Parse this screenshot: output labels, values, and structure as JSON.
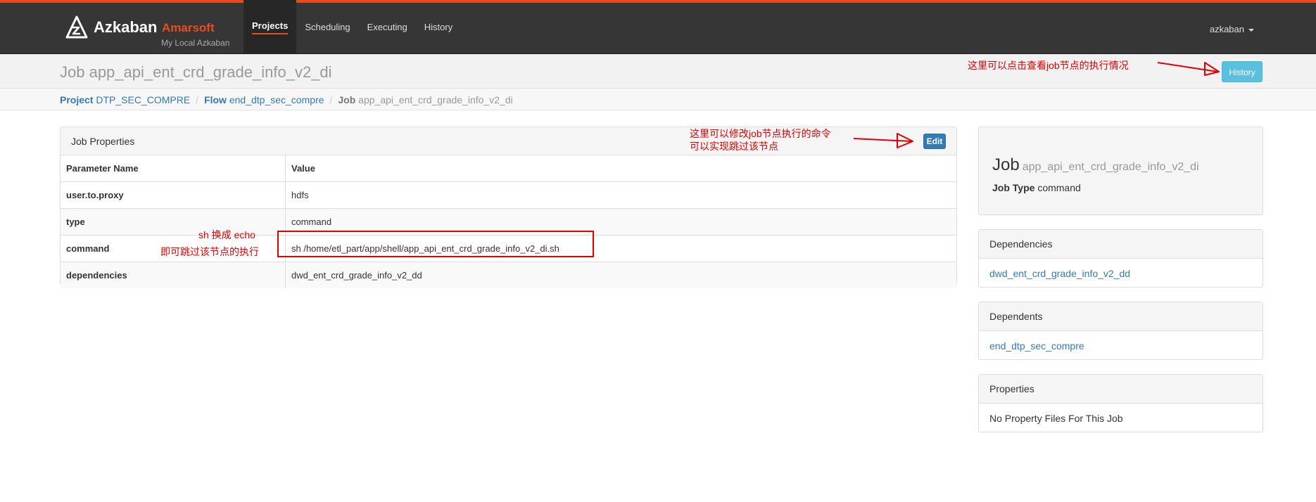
{
  "navbar": {
    "brand_name": "Azkaban",
    "brand_sub": "Amarsoft",
    "instance": "My Local Azkaban",
    "items": [
      {
        "label": "Projects",
        "active": true
      },
      {
        "label": "Scheduling",
        "active": false
      },
      {
        "label": "Executing",
        "active": false
      },
      {
        "label": "History",
        "active": false
      }
    ],
    "user": "azkaban",
    "accent_color": "#e84c1e"
  },
  "header": {
    "title": "Job app_api_ent_crd_grade_info_v2_di",
    "history_button": "History"
  },
  "breadcrumb": {
    "project_label": "Project",
    "project": "DTP_SEC_COMPRE",
    "flow_label": "Flow",
    "flow": "end_dtp_sec_compre",
    "job_label": "Job",
    "job": "app_api_ent_crd_grade_info_v2_di"
  },
  "properties": {
    "title": "Job Properties",
    "edit_button": "Edit",
    "columns": [
      "Parameter Name",
      "Value"
    ],
    "rows": [
      {
        "name": "user.to.proxy",
        "value": "hdfs"
      },
      {
        "name": "type",
        "value": "command"
      },
      {
        "name": "command",
        "value": "sh /home/etl_part/app/shell/app_api_ent_crd_grade_info_v2_di.sh"
      },
      {
        "name": "dependencies",
        "value": "dwd_ent_crd_grade_info_v2_dd"
      }
    ]
  },
  "summary": {
    "job_word": "Job",
    "job_name": "app_api_ent_crd_grade_info_v2_di",
    "type_label": "Job Type",
    "type_value": "command"
  },
  "dependencies": {
    "title": "Dependencies",
    "item": "dwd_ent_crd_grade_info_v2_dd"
  },
  "dependents": {
    "title": "Dependents",
    "item": "end_dtp_sec_compre"
  },
  "property_files": {
    "title": "Properties",
    "item": "No Property Files For This Job"
  },
  "annotations": {
    "history_note": "这里可以点击查看job节点的执行情况",
    "edit_note_line1": "这里可以修改job节点执行的命令",
    "edit_note_line2": "可以实现跳过该节点",
    "command_note_line1": "sh 换成 echo",
    "command_note_line2": "即可跳过该节点的执行",
    "color": "#e00000"
  }
}
